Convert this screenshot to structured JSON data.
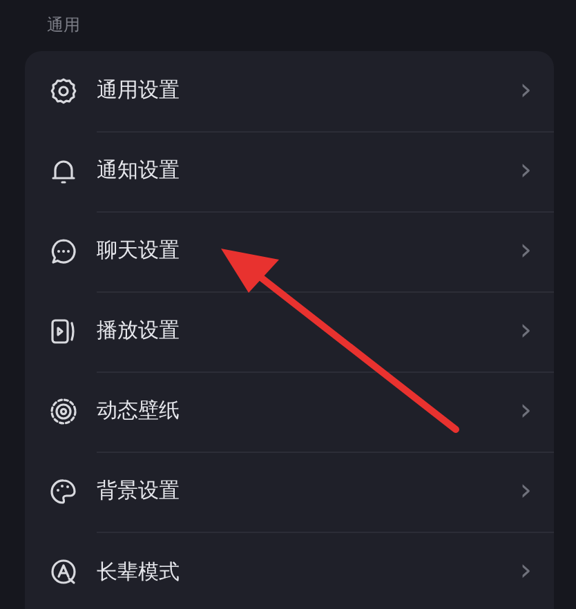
{
  "section": {
    "title": "通用"
  },
  "items": [
    {
      "kind": "gear",
      "label": "通用设置",
      "chevron": "›"
    },
    {
      "kind": "bell",
      "label": "通知设置",
      "chevron": "›"
    },
    {
      "kind": "chat",
      "label": "聊天设置",
      "chevron": "›"
    },
    {
      "kind": "play",
      "label": "播放设置",
      "chevron": "›"
    },
    {
      "kind": "wallpaper",
      "label": "动态壁纸",
      "chevron": "›"
    },
    {
      "kind": "palette",
      "label": "背景设置",
      "chevron": "›"
    },
    {
      "kind": "elder",
      "label": "长辈模式",
      "chevron": "›"
    }
  ]
}
